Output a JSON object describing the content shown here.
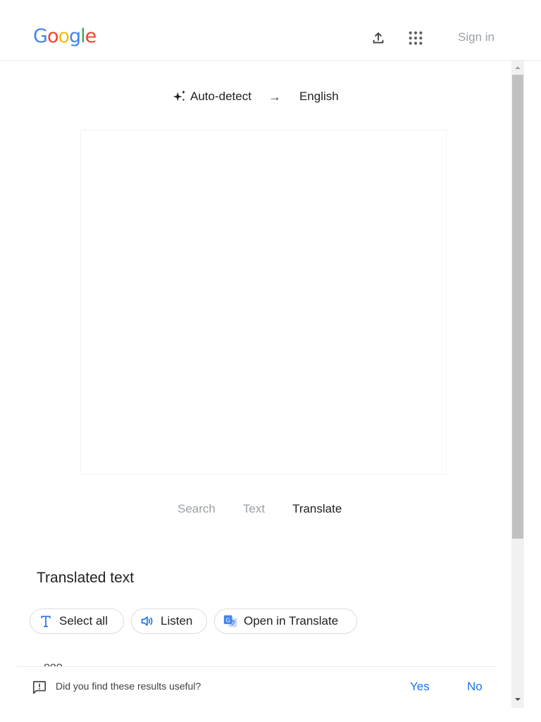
{
  "header": {
    "logo_letters": [
      "G",
      "o",
      "o",
      "g",
      "l",
      "e"
    ],
    "logo_colors": [
      "#4285f4",
      "#ea4335",
      "#fbbc05",
      "#4285f4",
      "#34a853",
      "#ea4335"
    ],
    "upload_icon": "upload-icon",
    "apps_icon": "apps-grid-icon",
    "signin_label": "Sign in"
  },
  "languages": {
    "source": "Auto-detect",
    "source_icon": "sparkle-icon",
    "arrow": "→",
    "target": "English"
  },
  "modes": {
    "items": [
      "Search",
      "Text",
      "Translate"
    ],
    "active": "Translate"
  },
  "result": {
    "title": "Translated text",
    "clipped_text": "ooo",
    "chips": {
      "select_all": "Select all",
      "listen": "Listen",
      "open_in_translate": "Open in Translate"
    }
  },
  "feedback": {
    "question": "Did you find these results useful?",
    "yes": "Yes",
    "no": "No"
  },
  "colors": {
    "accent": "#1a73e8",
    "muted_text": "#9aa0a6",
    "scroll_thumb": "#c1c1c1"
  }
}
